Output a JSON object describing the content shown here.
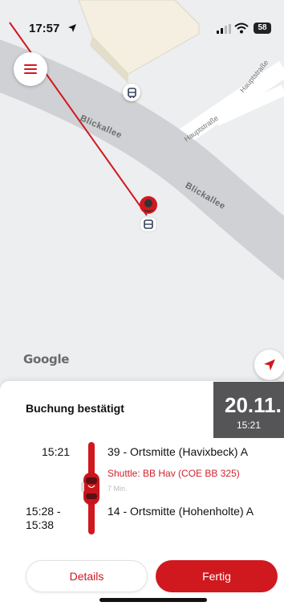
{
  "status_bar": {
    "time": "17:57",
    "battery": "58"
  },
  "map": {
    "roads": {
      "main_road_1": "Blickallee",
      "main_road_2": "Blickallee",
      "street_1": "Hauptstraße",
      "street_2": "Hauptstraße"
    },
    "attribution": "Google",
    "icons": {
      "menu": "hamburger-menu-icon",
      "bus_stop": "bus-stop-icon",
      "pin": "driver-location-pin-icon",
      "locate": "locate-arrow-icon"
    }
  },
  "booking": {
    "title": "Buchung bestätigt",
    "date": "20.11.",
    "date_time": "15:21",
    "departure": {
      "time": "15:21",
      "stop": "39 - Ortsmitte (Havixbeck) A"
    },
    "shuttle": "Shuttle: BB Hav (COE BB 325)",
    "duration": "7 Min.",
    "arrival": {
      "time": "15:28 - 15:38",
      "stop": "14 - Ortsmitte (Hohenholte) A"
    }
  },
  "actions": {
    "details_label": "Details",
    "done_label": "Fertig"
  },
  "colors": {
    "accent": "#d0181f",
    "date_box": "#555557",
    "map_bg": "#eceef0",
    "road": "#cfd1d4"
  }
}
